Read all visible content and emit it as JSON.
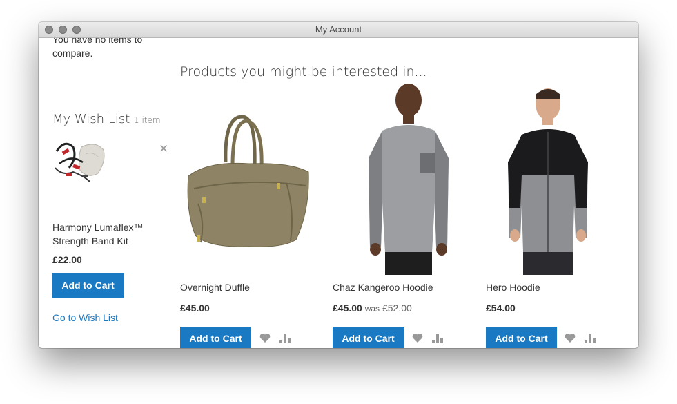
{
  "window": {
    "title": "My Account"
  },
  "sidebar": {
    "compare_text_line1": "You have no items to",
    "compare_text_line2": "compare.",
    "wishlist": {
      "title": "My Wish List",
      "count": "1 item",
      "item": {
        "name_line1": "Harmony Lumaflex™",
        "name_line2": "Strength Band Kit",
        "price": "£22.00",
        "add_to_cart": "Add to Cart"
      },
      "go_link": "Go to Wish List"
    }
  },
  "main": {
    "title": "Products you might be interested in...",
    "products": [
      {
        "name": "Overnight Duffle",
        "price": "£45.00",
        "add_to_cart": "Add to Cart"
      },
      {
        "name": "Chaz Kangeroo Hoodie",
        "price": "£45.00",
        "was_label": "was",
        "was_price": "£52.00",
        "add_to_cart": "Add to Cart"
      },
      {
        "name": "Hero Hoodie",
        "price": "£54.00",
        "add_to_cart": "Add to Cart"
      }
    ]
  },
  "colors": {
    "accent": "#1979c3",
    "text": "#333333",
    "icon": "#999999"
  },
  "icons": [
    "close-icon",
    "heart-icon",
    "compare-icon"
  ]
}
